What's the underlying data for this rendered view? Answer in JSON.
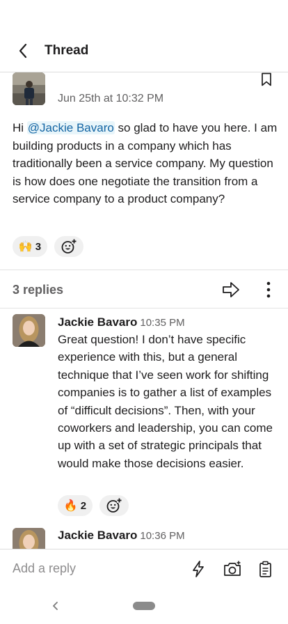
{
  "header": {
    "title": "Thread"
  },
  "parent_message": {
    "timestamp": "Jun 25th at 10:32 PM",
    "text_prefix": "Hi ",
    "mention": "@Jackie Bavaro",
    "text_suffix": " so glad to have you here. I am building products in a company which has traditionally been a service company. My question is how does one negotiate the transition from a service company to a product company?",
    "reactions": [
      {
        "emoji": "🙌",
        "count": "3"
      }
    ]
  },
  "replies_bar": {
    "count_label": "3 replies"
  },
  "replies": [
    {
      "author": "Jackie Bavaro",
      "time": "10:35 PM",
      "text": "Great question! I don’t have specific experience with this, but a general technique that I’ve seen work for shifting companies is to gather a list of examples of “difficult decisions”. Then, with your coworkers and leadership, you can come up with a set of strategic principals that would make those decisions easier.",
      "reactions": [
        {
          "emoji": "🔥",
          "count": "2"
        }
      ]
    },
    {
      "author": "Jackie Bavaro",
      "time": "10:36 PM"
    }
  ],
  "composer": {
    "placeholder": "Add a reply"
  },
  "icons": {
    "back": "chevron-left-icon",
    "bookmark": "bookmark-icon",
    "share": "share-arrow-icon",
    "more": "more-vertical-icon",
    "add_reaction": "add-reaction-icon",
    "shortcut": "lightning-icon",
    "camera": "camera-icon",
    "attachment": "clipboard-icon"
  },
  "colors": {
    "link": "#1264a3",
    "text": "#1d1c1d",
    "muted": "#616061"
  }
}
